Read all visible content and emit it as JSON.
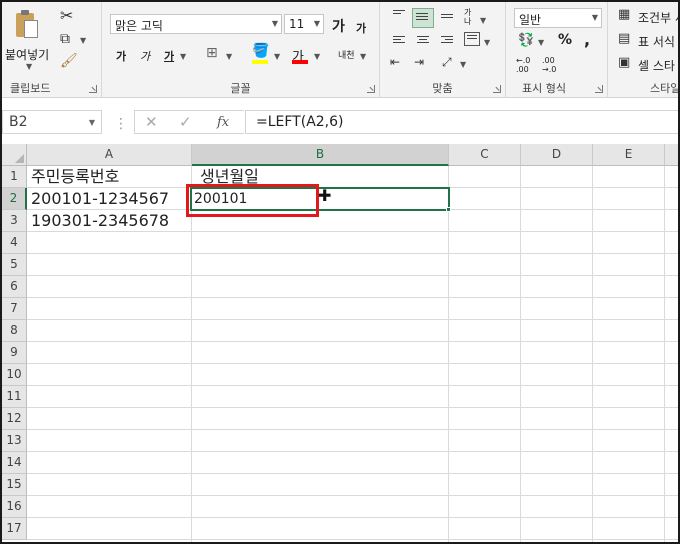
{
  "ribbon": {
    "clipboard": {
      "paste_label": "붙여넣기",
      "group_label": "클립보드"
    },
    "font": {
      "font_name": "맑은 고딕",
      "font_size": "11",
      "grow_label": "가",
      "shrink_label": "가",
      "bold_label": "가",
      "italic_label": "가",
      "underline_label": "가",
      "font_color_label": "가",
      "phonetic_label": "내천",
      "group_label": "글꼴"
    },
    "alignment": {
      "wrap_label": "가나",
      "group_label": "맞춤"
    },
    "number": {
      "format_value": "일반",
      "percent_label": "%",
      "comma_label": ",",
      "inc_decimal_label": "←.0 .00",
      "dec_decimal_label": ".00 →.0",
      "group_label": "표시 형식"
    },
    "styles": {
      "conditional_label": "조건부 서",
      "table_label": "표 서식",
      "cell_styles_label": "셀 스타",
      "group_label": "스타일"
    }
  },
  "formula_bar": {
    "name_box": "B2",
    "formula": "=LEFT(A2,6)",
    "cancel_icon": "✕",
    "enter_icon": "✓",
    "fx_label": "fx"
  },
  "sheet": {
    "columns": [
      "A",
      "B",
      "C",
      "D",
      "E"
    ],
    "rows": [
      "1",
      "2",
      "3",
      "4",
      "5",
      "6",
      "7",
      "8",
      "9",
      "10",
      "11",
      "12",
      "13",
      "14",
      "15",
      "16",
      "17"
    ],
    "selected_column": "B",
    "selected_row": "2",
    "cells": {
      "A1": "주민등록번호",
      "B1": "생년월일",
      "A2": "200101-1234567",
      "B2": "200101",
      "A3": "190301-2345678"
    }
  },
  "colors": {
    "excel_green": "#217346",
    "highlight_red": "#e0191c"
  }
}
